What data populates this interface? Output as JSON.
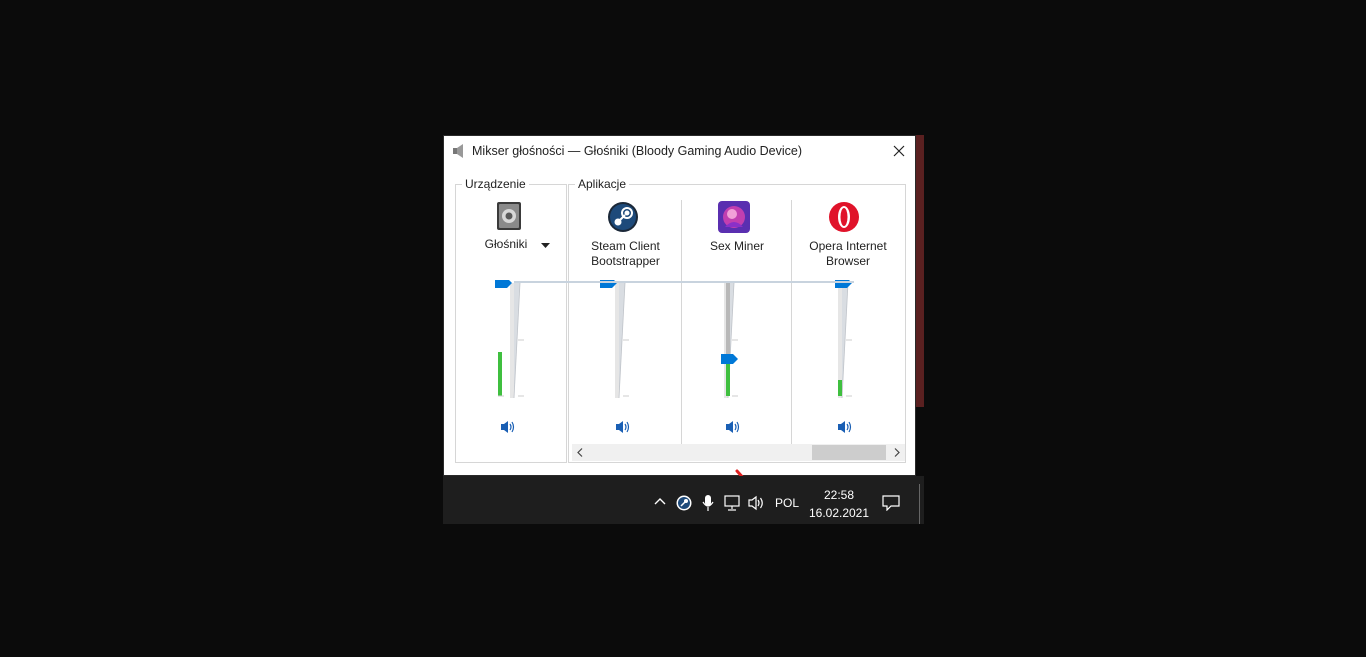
{
  "window": {
    "title": "Mikser głośności — Głośniki (Bloody Gaming Audio Device)",
    "close_icon": "close-icon"
  },
  "device": {
    "group_label": "Urządzenie",
    "name": "Głośniki",
    "icon": "speaker-device-icon",
    "volume_percent": 100,
    "peak_percent": 40
  },
  "applications": {
    "group_label": "Aplikacje",
    "items": [
      {
        "name_line1": "Steam Client",
        "name_line2": "Bootstrapper",
        "icon": "steam-icon",
        "volume_percent": 100,
        "peak_percent": 0
      },
      {
        "name_line1": "Sex Miner",
        "name_line2": "",
        "icon": "sex-miner-app-icon",
        "volume_percent": 35,
        "peak_percent": 30
      },
      {
        "name_line1": "Opera Internet",
        "name_line2": "Browser",
        "icon": "opera-icon",
        "volume_percent": 100,
        "peak_percent": 15
      }
    ]
  },
  "taskbar": {
    "tray_icons": [
      "chevron-up-icon",
      "steam-tray-icon",
      "microphone-icon",
      "network-icon",
      "volume-icon"
    ],
    "language": "POL",
    "time": "22:58",
    "date": "16.02.2021",
    "notifications_icon": "notifications-icon"
  },
  "colors": {
    "accent": "#0078d7",
    "meter": "#3fbf3f",
    "annotation_arrow": "#e02020"
  }
}
